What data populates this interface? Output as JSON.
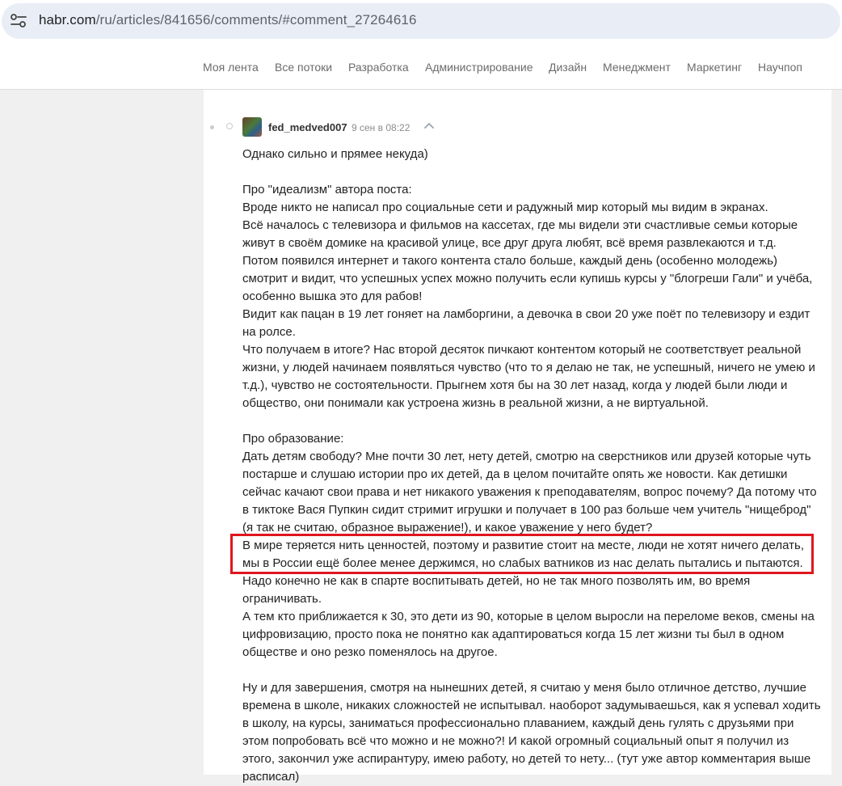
{
  "browser": {
    "url_host": "habr.com",
    "url_path": "/ru/articles/841656/comments/#comment_27264616",
    "site_info_icon": "tune-icon"
  },
  "nav": {
    "items": [
      "Моя лента",
      "Все потоки",
      "Разработка",
      "Администрирование",
      "Дизайн",
      "Менеджмент",
      "Маркетинг",
      "Научпоп"
    ]
  },
  "comment": {
    "author": "fed_medved007",
    "date": "9 сен в 08:22",
    "lines": [
      "Однако сильно и прямее некуда)",
      "",
      "Про \"идеализм\" автора поста:",
      "Вроде никто не написал про социальные сети и радужный мир который мы видим в экранах.",
      "Всё началось с телевизора и фильмов на кассетах, где мы видели эти счастливые семьи которые",
      "живут в своём домике на красивой улице, все друг друга любят, всё время развлекаются и т.д.",
      "Потом появился интернет и такого контента стало больше, каждый день (особенно молодежь)",
      "смотрит и видит, что успешных успех можно получить если купишь курсы у \"блогреши Гали\" и учёба,",
      "особенно вышка это для рабов!",
      "Видит как пацан в 19 лет гоняет на ламборгини, а девочка в свои 20 уже поёт по телевизору и ездит",
      "на ролсе.",
      "Что получаем в итоге? Нас второй десяток пичкают контентом который не соответствует реальной",
      "жизни, у людей начинаем появляться чувство (что то я делаю не так, не успешный, ничего не умею и",
      "т.д.), чувство не состоятельности. Прыгнем хотя бы на 30 лет назад, когда у людей были люди и",
      "общество, они понимали как устроена жизнь в реальной жизни, а не виртуальной.",
      "",
      "Про образование:",
      "Дать детям свободу? Мне почти 30 лет, нету детей, смотрю на сверстников или друзей которые чуть",
      "постарше и слушаю истории про их детей, да в целом почитайте опять же новости. Как детишки",
      "сейчас качают свои права и нет никакого уважения к преподавателям, вопрос почему? Да потому что",
      "в тиктоке Вася Пупкин сидит стримит игрушки и получает в 100 раз больше чем учитель \"нищеброд\"",
      "(я так не считаю, образное выражение!), и какое уважение у него будет?",
      "В мире теряется нить ценностей, поэтому и развитие стоит на месте, люди не хотят ничего делать,",
      "мы в России ещё более менее держимся, но слабых ватников из нас делать пытались и пытаются.",
      "Надо конечно не как в спарте воспитывать детей, но не так много позволять им, во время",
      "ограничивать.",
      "А тем кто приближается к 30, это дети из 90, которые в целом выросли на переломе веков, смены на",
      "цифровизацию, просто пока не понятно как адаптироваться когда 15 лет жизни ты был в одном",
      "обществе и оно резко поменялось на другое.",
      "",
      "Ну и для завершения, смотря на нынешних детей, я считаю у меня было отличное детство, лучшие",
      "времена в школе, никаких сложностей не испытывал. наоборот задумываешься, как я успевал ходить",
      "в школу, на курсы, заниматься профессионально плаванием, каждый день гулять с друзьями при",
      "этом попробовать всё что можно и не можно?! И какой огромный социальный опыт я получил из",
      "этого, закончил уже аспирантуру, имею работу, но детей то нету... (тут уже автор комментария выше",
      "расписал)"
    ]
  },
  "colors": {
    "highlight_box": "#e0161e",
    "address_bar": "#e9eef6"
  }
}
